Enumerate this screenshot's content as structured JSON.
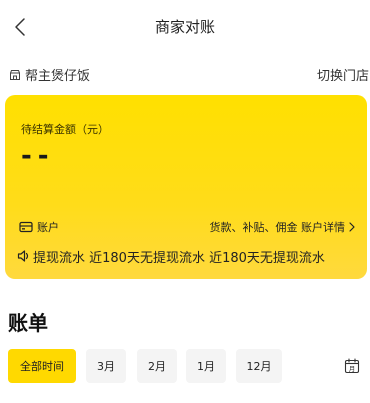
{
  "nav": {
    "title": "商家对账",
    "back_icon": "chevron-left-icon"
  },
  "store": {
    "name": "帮主煲仔饭",
    "icon": "store-icon",
    "switch_label": "切换门店"
  },
  "card": {
    "pending_label": "待结算金额（元）",
    "pending_amount": "--",
    "account_label": "账户",
    "account_icon": "wallet-icon",
    "account_detail": "货款、补贴、佣金 账户详情",
    "chevron_icon": "chevron-right-icon",
    "ticker_icon": "speaker-icon",
    "ticker_text": "提现流水    近180天无提现流水    近180天无提现流水",
    "background_color": "#ffdf00"
  },
  "bill": {
    "title": "账单",
    "filters": [
      {
        "label": "全部时间",
        "active": true
      },
      {
        "label": "3月",
        "active": false
      },
      {
        "label": "2月",
        "active": false
      },
      {
        "label": "1月",
        "active": false
      },
      {
        "label": "12月",
        "active": false
      }
    ],
    "calendar_icon": "calendar-icon",
    "calendar_glyph": "月",
    "accent_color": "#ffd900"
  }
}
